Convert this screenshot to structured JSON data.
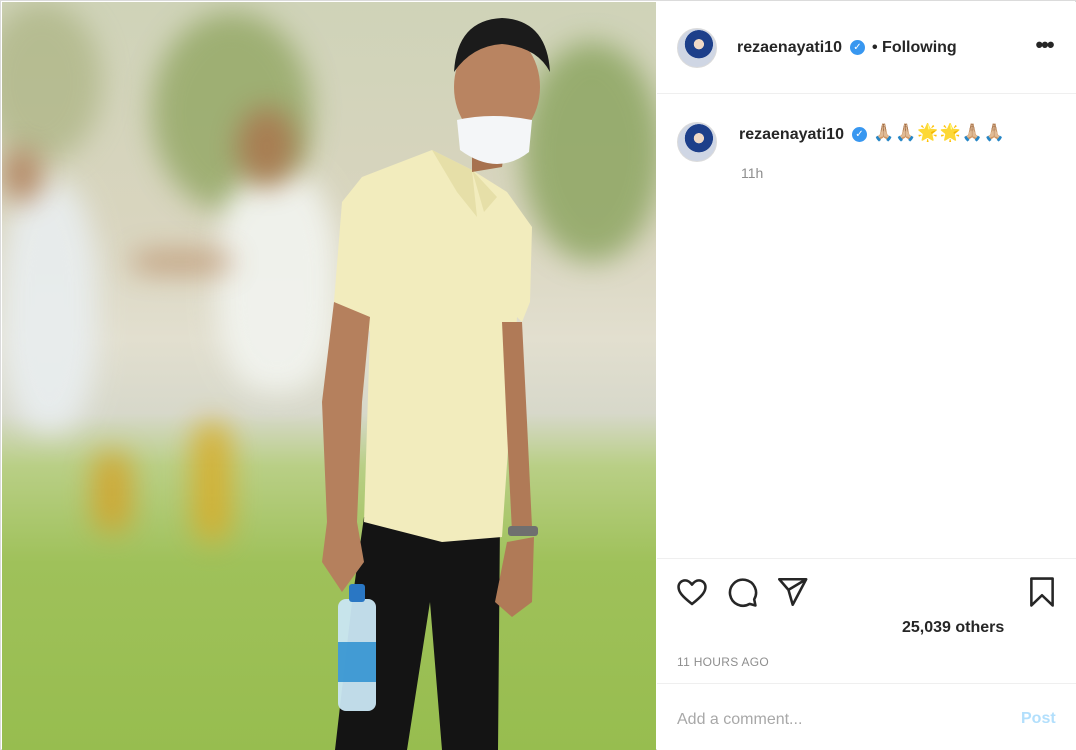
{
  "post": {
    "username": "rezaenayati10",
    "verified_mark": "✓",
    "following_label": "• Following",
    "more_icon": "more-options-icon",
    "caption_emoji": "🙏🏼🙏🏼🌟🌟🙏🏼🙏🏼",
    "caption_time": "11h",
    "likes_text": "25,039 others",
    "timestamp": "11 HOURS AGO",
    "comment_placeholder": "Add a comment...",
    "post_label": "Post"
  },
  "icons": {
    "like": "heart-icon",
    "comment": "comment-bubble-icon",
    "share": "paper-plane-icon",
    "save": "bookmark-icon"
  },
  "colors": {
    "accent": "#3897f0",
    "post_disabled": "#b2dffc",
    "muted": "#8e8e8e"
  }
}
